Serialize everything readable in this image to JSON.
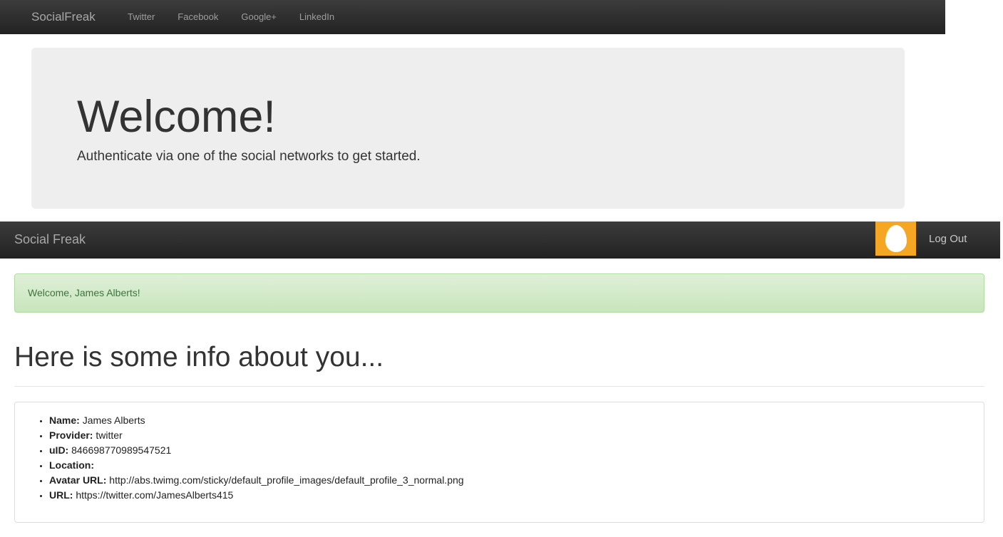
{
  "nav_top": {
    "brand": "SocialFreak",
    "links": [
      "Twitter",
      "Facebook",
      "Google+",
      "LinkedIn"
    ]
  },
  "jumbotron": {
    "heading": "Welcome!",
    "text": "Authenticate via one of the social networks to get started."
  },
  "nav_profile": {
    "brand": "Social Freak",
    "avatar_icon": "twitter-egg-avatar-icon",
    "avatar_color": "#f5a623",
    "logout_label": "Log Out"
  },
  "alert": {
    "text": "Welcome, James Alberts!",
    "color": "#dff0d8"
  },
  "page_header": {
    "title": "Here is some info about you..."
  },
  "info": [
    {
      "label": "Name:",
      "value": "James Alberts"
    },
    {
      "label": "Provider:",
      "value": "twitter"
    },
    {
      "label": "uID:",
      "value": "846698770989547521"
    },
    {
      "label": "Location:",
      "value": ""
    },
    {
      "label": "Avatar URL:",
      "value": "http://abs.twimg.com/sticky/default_profile_images/default_profile_3_normal.png"
    },
    {
      "label": "URL:",
      "value": "https://twitter.com/JamesAlberts415"
    }
  ]
}
